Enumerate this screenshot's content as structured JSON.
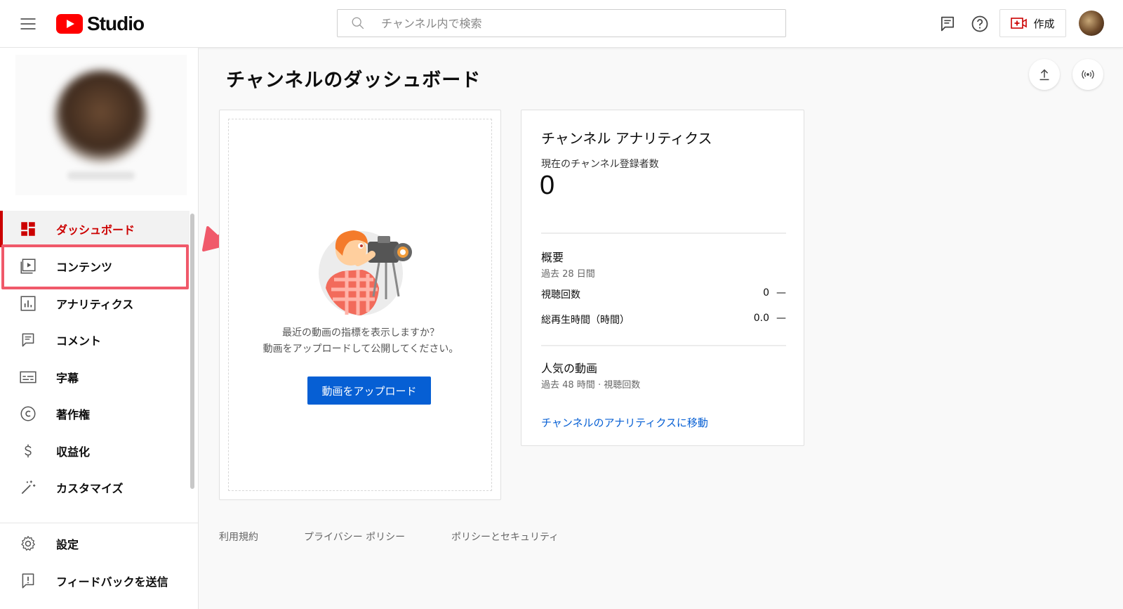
{
  "header": {
    "brand": "Studio",
    "search_placeholder": "チャンネル内で検索",
    "create_label": "作成"
  },
  "sidebar": {
    "items": [
      {
        "label": "ダッシュボード",
        "icon": "dashboard-icon",
        "active": true
      },
      {
        "label": "コンテンツ",
        "icon": "content-icon"
      },
      {
        "label": "アナリティクス",
        "icon": "analytics-icon"
      },
      {
        "label": "コメント",
        "icon": "comment-icon"
      },
      {
        "label": "字幕",
        "icon": "subtitles-icon"
      },
      {
        "label": "著作権",
        "icon": "copyright-icon"
      },
      {
        "label": "収益化",
        "icon": "dollar-icon"
      },
      {
        "label": "カスタマイズ",
        "icon": "magic-wand-icon"
      }
    ],
    "bottom_items": [
      {
        "label": "設定",
        "icon": "gear-icon"
      },
      {
        "label": "フィードバックを送信",
        "icon": "feedback-icon"
      }
    ]
  },
  "main": {
    "title": "チャンネルのダッシュボード",
    "upload_card": {
      "line1": "最近の動画の指標を表示しますか？",
      "line2": "動画をアップロードして公開してください。",
      "button": "動画をアップロード"
    },
    "analytics": {
      "title": "チャンネル アナリティクス",
      "subscribers_label": "現在のチャンネル登録者数",
      "subscribers_value": "0",
      "summary_title": "概要",
      "summary_period": "過去 28 日間",
      "rows": [
        {
          "label": "視聴回数",
          "value": "0",
          "delta": "—"
        },
        {
          "label": "総再生時間（時間）",
          "value": "0.0",
          "delta": "—"
        }
      ],
      "popular_title": "人気の動画",
      "popular_period": "過去 48 時間 · 視聴回数",
      "link": "チャンネルのアナリティクスに移動"
    }
  },
  "footer": {
    "links": [
      "利用規約",
      "プライバシー ポリシー",
      "ポリシーとセキュリティ"
    ]
  },
  "colors": {
    "accent_red": "#cc0000",
    "link_blue": "#065fd4",
    "annotation": "#f0596a"
  }
}
